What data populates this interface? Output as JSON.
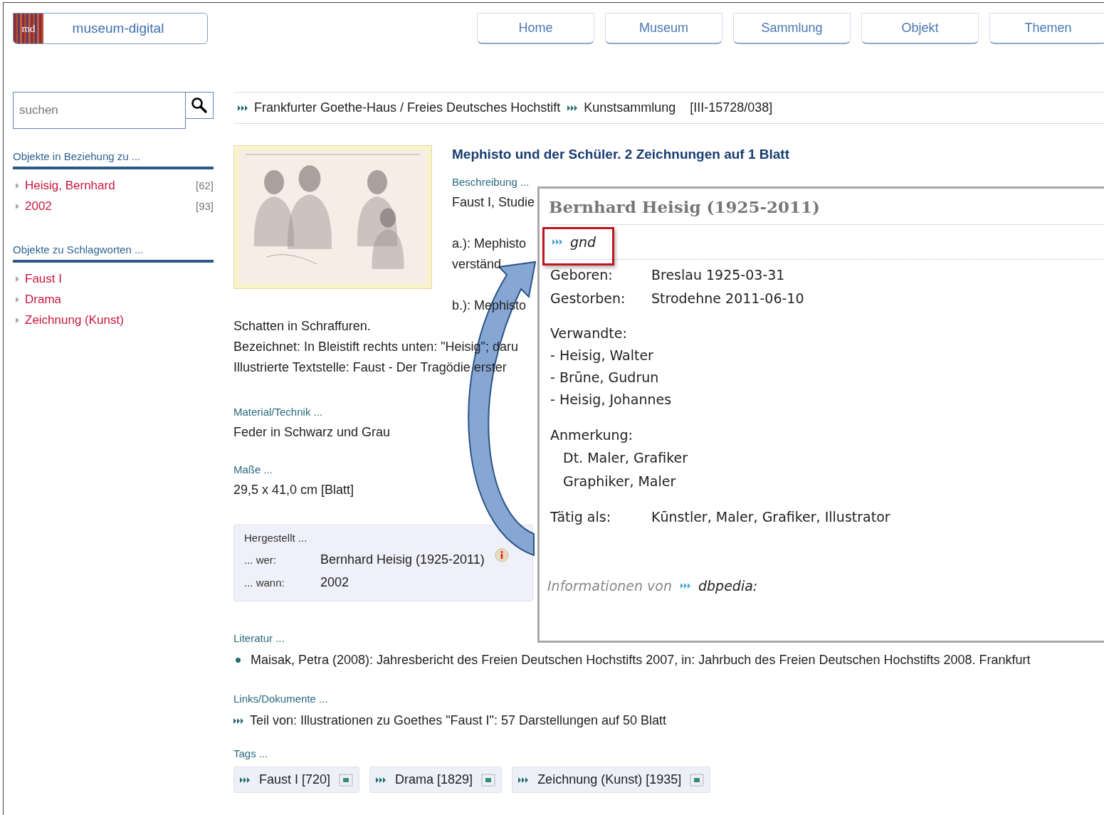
{
  "logo": {
    "mark": "md",
    "title": "museum-digital"
  },
  "nav": [
    {
      "label": "Home"
    },
    {
      "label": "Museum"
    },
    {
      "label": "Sammlung"
    },
    {
      "label": "Objekt"
    },
    {
      "label": "Themen"
    }
  ],
  "search": {
    "placeholder": "suchen"
  },
  "sidebar": [
    {
      "heading": "Objekte in Beziehung zu ...",
      "items": [
        {
          "label": "Heisig, Bernhard",
          "count": "[62]"
        },
        {
          "label": "2002",
          "count": "[93]"
        }
      ]
    },
    {
      "heading": "Objekte zu Schlagworten ...",
      "items": [
        {
          "label": "Faust I"
        },
        {
          "label": "Drama"
        },
        {
          "label": "Zeichnung (Kunst)"
        }
      ]
    }
  ],
  "breadcrumb": {
    "items": [
      "Frankfurter Goethe-Haus / Freies Deutsches Hochstift",
      "Kunstsammlung"
    ],
    "inventory": "[III-15728/038]"
  },
  "object": {
    "title": "Mephisto und der Schüler. 2 Zeichnungen auf 1 Blatt",
    "description": {
      "label": "Beschreibung ...",
      "paragraphs": [
        [
          "Faust I, Studie"
        ],
        [
          "a.): Mephisto",
          "verständ"
        ],
        [
          "b.): Mephisto",
          "Schatten in Schraffuren.",
          "Bezeichnet: In Bleistift rechts unten: \"Heisig\"; daru",
          "Illustrierte Textstelle: Faust - Der Tragödie erster"
        ]
      ]
    },
    "fields": [
      {
        "label": "Material/Technik ...",
        "value": "Feder in Schwarz und Grau"
      },
      {
        "label": "Maße ...",
        "value": "29,5 x 41,0 cm [Blatt]"
      }
    ],
    "production": {
      "label": "Hergestellt ...",
      "rows": [
        {
          "label": "... wer:",
          "value": "Bernhard Heisig (1925-2011)",
          "info": true
        },
        {
          "label": "... wann:",
          "value": "2002",
          "info": false
        }
      ]
    },
    "literature": {
      "label": "Literatur ...",
      "items": [
        "Maisak, Petra (2008): Jahresbericht des Freien Deutschen Hochstifts 2007, in: Jahrbuch des Freien Deutschen Hochstifts 2008. Frankfurt"
      ]
    },
    "links": {
      "label": "Links/Dokumente ...",
      "items": [
        "Teil von: Illustrationen zu Goethes \"Faust I\": 57 Darstellungen auf 50 Blatt"
      ]
    },
    "tags": {
      "label": "Tags ...",
      "items": [
        "Faust I [720]",
        "Drama [1829]",
        "Zeichnung (Kunst) [1935]"
      ]
    }
  },
  "popup": {
    "title": "Bernhard Heisig (1925-2011)",
    "link": "gnd",
    "facts": [
      {
        "label": "Geboren:",
        "value": "Breslau 1925-03-31"
      },
      {
        "label": "Gestorben:",
        "value": "Strodehne 2011-06-10"
      }
    ],
    "relatives": {
      "label": "Verwandte:",
      "items": [
        "- Heisig, Walter",
        "- Brūne, Gudrun",
        "- Heisig, Johannes"
      ]
    },
    "notes": {
      "label": "Anmerkung:",
      "items": [
        "Dt. Maler, Grafiker",
        "Graphiker, Maler"
      ]
    },
    "occupation": {
      "label": "Tätig als:",
      "value": "Kūnstler, Maler, Grafiker, Illustrator"
    },
    "source": {
      "text": "Informationen von",
      "link": "dbpedia:"
    }
  }
}
